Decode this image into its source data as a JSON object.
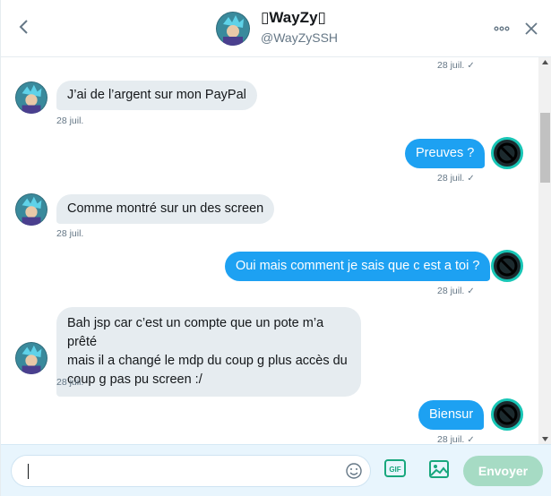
{
  "header": {
    "name": "▯WayZy▯",
    "handle": "@WayZySSH"
  },
  "messages": [
    {
      "side": "out",
      "time": "28 juil.",
      "read": "✓"
    },
    {
      "side": "in",
      "text": "J’ai de l’argent sur mon PayPal",
      "time": "28 juil."
    },
    {
      "side": "out",
      "text": "Preuves ?",
      "time": "28 juil.",
      "read": "✓"
    },
    {
      "side": "in",
      "text": "Comme montré sur un des screen",
      "time": "28 juil."
    },
    {
      "side": "out",
      "text": "Oui mais comment je sais que c est a toi ?",
      "time": "28 juil.",
      "read": "✓"
    },
    {
      "side": "in",
      "text": "Bah jsp car c’est un compte que un pote m’a prêté\nmais il a changé le mdp du coup g plus accès du\ncoup g pas pu screen :/",
      "time": "28 juil."
    },
    {
      "side": "out",
      "text": "Biensur",
      "time": "28 juil.",
      "read": "✓"
    }
  ],
  "composer": {
    "placeholder": "",
    "gif_label": "GIF",
    "send_label": "Envoyer"
  },
  "colors": {
    "accent": "#1da1f2",
    "incoming_bubble": "#e6ecf0",
    "send_disabled": "#a6dbc4",
    "composer_bg": "#e8f5fd"
  },
  "icons": {
    "back": "chevron-left-icon",
    "more": "more-dots-icon",
    "close": "close-icon",
    "emoji": "emoji-icon",
    "gif": "gif-icon",
    "media": "image-icon"
  }
}
